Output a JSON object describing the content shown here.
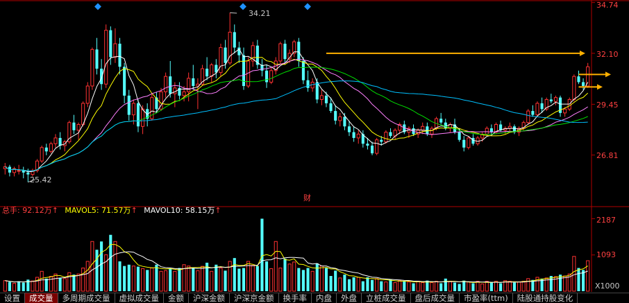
{
  "chart_data": [
    {
      "type": "candlestick",
      "price_axis_ticks": [
        "34.74",
        "32.10",
        "29.45",
        "26.81"
      ],
      "ylim": [
        24.2,
        34.8
      ],
      "annotations": {
        "high_label": "34.21",
        "low_label": "25.42",
        "finance_marker": "财"
      },
      "candles": [
        [
          26.1,
          26.4,
          25.8,
          26.2
        ],
        [
          26.2,
          26.3,
          25.7,
          25.9
        ],
        [
          25.9,
          26.2,
          25.7,
          26.1
        ],
        [
          26.0,
          26.3,
          25.8,
          26.0
        ],
        [
          26.0,
          26.2,
          25.6,
          25.9
        ],
        [
          25.9,
          26.1,
          25.4,
          25.8
        ],
        [
          25.8,
          26.1,
          25.7,
          26.0
        ],
        [
          26.0,
          26.6,
          25.9,
          26.5
        ],
        [
          26.5,
          27.3,
          26.4,
          27.2
        ],
        [
          27.2,
          27.4,
          26.8,
          27.0
        ],
        [
          27.0,
          27.5,
          26.9,
          27.4
        ],
        [
          27.4,
          27.9,
          27.2,
          27.7
        ],
        [
          27.7,
          28.0,
          27.1,
          27.3
        ],
        [
          27.3,
          27.6,
          27.0,
          27.5
        ],
        [
          27.5,
          28.6,
          27.4,
          28.5
        ],
        [
          28.5,
          28.9,
          27.9,
          28.1
        ],
        [
          28.1,
          28.5,
          27.6,
          28.4
        ],
        [
          28.4,
          29.6,
          28.3,
          29.5
        ],
        [
          29.5,
          30.6,
          29.3,
          30.4
        ],
        [
          30.4,
          32.4,
          30.2,
          32.3
        ],
        [
          32.3,
          32.9,
          31.0,
          31.3
        ],
        [
          31.3,
          31.8,
          30.2,
          30.5
        ],
        [
          30.5,
          33.6,
          30.3,
          33.3
        ],
        [
          33.3,
          33.5,
          31.5,
          31.9
        ],
        [
          31.9,
          33.4,
          31.6,
          32.6
        ],
        [
          32.6,
          32.9,
          31.0,
          31.4
        ],
        [
          31.4,
          31.6,
          29.5,
          29.9
        ],
        [
          29.9,
          30.2,
          28.6,
          28.9
        ],
        [
          28.9,
          29.7,
          28.4,
          29.5
        ],
        [
          29.5,
          29.7,
          28.0,
          28.3
        ],
        [
          28.3,
          29.4,
          27.9,
          29.2
        ],
        [
          29.2,
          29.5,
          28.3,
          28.7
        ],
        [
          28.7,
          30.0,
          28.6,
          29.8
        ],
        [
          29.8,
          30.1,
          29.0,
          29.2
        ],
        [
          29.2,
          30.3,
          29.1,
          30.1
        ],
        [
          30.1,
          31.1,
          29.8,
          30.9
        ],
        [
          30.9,
          31.7,
          29.8,
          30.0
        ],
        [
          30.0,
          30.6,
          29.3,
          30.3
        ],
        [
          30.3,
          30.6,
          29.7,
          29.9
        ],
        [
          29.9,
          30.4,
          29.6,
          30.1
        ],
        [
          30.1,
          31.1,
          29.6,
          30.8
        ],
        [
          30.8,
          31.5,
          30.2,
          30.4
        ],
        [
          30.4,
          30.8,
          29.2,
          30.5
        ],
        [
          30.5,
          31.5,
          30.4,
          31.3
        ],
        [
          31.3,
          31.9,
          30.7,
          30.9
        ],
        [
          30.9,
          31.6,
          30.6,
          31.5
        ],
        [
          31.5,
          31.8,
          30.8,
          31.1
        ],
        [
          31.1,
          32.6,
          30.9,
          32.4
        ],
        [
          32.4,
          32.8,
          31.3,
          31.6
        ],
        [
          31.6,
          34.21,
          31.5,
          33.2
        ],
        [
          33.2,
          33.6,
          32.1,
          32.4
        ],
        [
          32.4,
          32.7,
          31.6,
          32.0
        ],
        [
          32.0,
          32.4,
          30.2,
          30.4
        ],
        [
          30.4,
          31.9,
          30.3,
          31.7
        ],
        [
          31.7,
          32.7,
          31.4,
          32.5
        ],
        [
          32.5,
          32.8,
          31.3,
          31.5
        ],
        [
          31.5,
          31.8,
          30.9,
          31.2
        ],
        [
          31.2,
          31.5,
          30.3,
          30.6
        ],
        [
          30.6,
          31.4,
          30.5,
          31.2
        ],
        [
          31.2,
          31.9,
          31.0,
          31.7
        ],
        [
          31.7,
          32.7,
          31.5,
          32.6
        ],
        [
          32.6,
          32.8,
          31.6,
          31.8
        ],
        [
          31.8,
          32.3,
          31.6,
          32.1
        ],
        [
          32.1,
          32.8,
          31.9,
          32.7
        ],
        [
          32.7,
          32.9,
          31.4,
          31.7
        ],
        [
          31.7,
          31.9,
          30.5,
          30.7
        ],
        [
          30.7,
          31.2,
          30.1,
          30.3
        ],
        [
          30.3,
          30.8,
          30.1,
          30.6
        ],
        [
          30.6,
          30.8,
          29.5,
          29.7
        ],
        [
          29.7,
          30.2,
          29.4,
          29.9
        ],
        [
          29.9,
          30.1,
          29.3,
          29.5
        ],
        [
          29.5,
          29.8,
          29.0,
          29.1
        ],
        [
          29.1,
          29.4,
          28.4,
          28.6
        ],
        [
          28.6,
          29.0,
          28.3,
          28.8
        ],
        [
          28.8,
          29.0,
          28.1,
          28.3
        ],
        [
          28.3,
          28.6,
          27.8,
          28.0
        ],
        [
          28.0,
          28.3,
          27.5,
          27.7
        ],
        [
          27.7,
          28.1,
          27.4,
          27.9
        ],
        [
          27.9,
          28.1,
          27.2,
          27.4
        ],
        [
          27.4,
          27.7,
          27.1,
          27.3
        ],
        [
          27.3,
          27.5,
          26.8,
          26.9
        ],
        [
          26.9,
          27.7,
          26.8,
          27.6
        ],
        [
          27.6,
          27.8,
          27.3,
          27.5
        ],
        [
          27.5,
          28.1,
          27.4,
          28.0
        ],
        [
          28.0,
          28.2,
          27.7,
          27.8
        ],
        [
          27.8,
          28.2,
          27.6,
          28.1
        ],
        [
          28.1,
          28.5,
          27.9,
          28.4
        ],
        [
          28.4,
          28.6,
          27.9,
          28.0
        ],
        [
          28.0,
          28.3,
          27.7,
          28.2
        ],
        [
          28.2,
          28.4,
          27.8,
          27.9
        ],
        [
          27.9,
          28.2,
          27.7,
          28.1
        ],
        [
          28.1,
          28.5,
          27.9,
          28.3
        ],
        [
          28.3,
          28.5,
          27.8,
          27.9
        ],
        [
          27.9,
          28.3,
          27.7,
          28.2
        ],
        [
          28.2,
          28.8,
          28.1,
          28.7
        ],
        [
          28.7,
          29.0,
          28.4,
          28.5
        ],
        [
          28.5,
          28.7,
          28.1,
          28.2
        ],
        [
          28.2,
          28.5,
          28.0,
          28.4
        ],
        [
          28.4,
          28.7,
          27.9,
          28.0
        ],
        [
          28.0,
          28.2,
          27.5,
          27.6
        ],
        [
          27.6,
          27.8,
          27.0,
          27.2
        ],
        [
          27.2,
          27.8,
          27.1,
          27.7
        ],
        [
          27.7,
          27.9,
          27.3,
          27.4
        ],
        [
          27.4,
          27.8,
          27.3,
          27.7
        ],
        [
          27.7,
          28.0,
          27.5,
          27.9
        ],
        [
          27.9,
          28.3,
          27.8,
          28.2
        ],
        [
          28.2,
          28.4,
          27.9,
          28.0
        ],
        [
          28.0,
          28.5,
          27.9,
          28.4
        ],
        [
          28.4,
          28.6,
          28.0,
          28.1
        ],
        [
          28.1,
          28.3,
          27.9,
          28.2
        ],
        [
          28.2,
          28.5,
          28.0,
          28.3
        ],
        [
          28.3,
          28.4,
          27.9,
          28.0
        ],
        [
          28.0,
          28.3,
          27.8,
          28.2
        ],
        [
          28.2,
          28.6,
          28.1,
          28.5
        ],
        [
          28.5,
          29.2,
          28.4,
          29.1
        ],
        [
          29.1,
          29.4,
          28.8,
          28.9
        ],
        [
          28.9,
          29.6,
          28.8,
          29.5
        ],
        [
          29.5,
          29.8,
          29.0,
          29.2
        ],
        [
          29.2,
          29.8,
          29.1,
          29.7
        ],
        [
          29.7,
          30.0,
          29.5,
          29.6
        ],
        [
          29.6,
          29.9,
          29.4,
          29.8
        ],
        [
          29.8,
          29.9,
          28.8,
          29.0
        ],
        [
          29.0,
          29.3,
          28.8,
          29.2
        ],
        [
          29.2,
          29.8,
          29.1,
          29.7
        ],
        [
          29.7,
          31.0,
          29.6,
          30.9
        ],
        [
          30.9,
          31.2,
          30.5,
          30.6
        ],
        [
          30.6,
          30.8,
          30.2,
          30.4
        ],
        [
          30.4,
          31.6,
          30.3,
          31.4
        ]
      ],
      "forecast_arrows": [
        32.1,
        31.0,
        30.35
      ]
    },
    {
      "type": "bar",
      "indicator_line": {
        "label1": "总手: ",
        "value1": "92.12万",
        "label2": "MAVOL5: ",
        "value2": "71.57万",
        "label3": "MAVOL10: ",
        "value3": "58.15万",
        "arrow": "↑"
      },
      "volume_axis_ticks": [
        "2187",
        "1093"
      ],
      "volume_unit": "X1000",
      "ylim": [
        0,
        2300
      ],
      "volumes": [
        320,
        280,
        240,
        300,
        260,
        350,
        310,
        420,
        600,
        380,
        450,
        520,
        400,
        380,
        560,
        500,
        520,
        700,
        900,
        1500,
        1250,
        1500,
        1100,
        1700,
        1500,
        900,
        760,
        800,
        760,
        740,
        680,
        640,
        700,
        800,
        600,
        620,
        680,
        600,
        700,
        800,
        760,
        700,
        620,
        750,
        860,
        600,
        800,
        700,
        620,
        900,
        1000,
        680,
        700,
        900,
        780,
        760,
        2187,
        900,
        680,
        1500,
        700,
        980,
        820,
        880,
        700,
        640,
        700,
        600,
        840,
        760,
        700,
        460,
        620,
        400,
        500,
        360,
        420,
        420,
        300,
        420,
        340,
        380,
        300,
        280,
        360,
        260,
        320,
        300,
        280,
        240,
        300,
        260,
        320,
        260,
        300,
        240,
        380,
        300,
        260,
        220,
        320,
        280,
        240,
        300,
        220,
        300,
        260,
        300,
        240,
        320,
        300,
        260,
        280,
        300,
        380,
        340,
        420,
        380,
        400,
        460,
        440,
        500,
        460,
        520,
        1050,
        700,
        640,
        920
      ],
      "rising": [
        1,
        0,
        1,
        0,
        0,
        0,
        1,
        1,
        1,
        0,
        1,
        1,
        0,
        1,
        1,
        0,
        1,
        1,
        1,
        1,
        0,
        0,
        1,
        0,
        1,
        0,
        0,
        0,
        1,
        0,
        1,
        0,
        1,
        0,
        1,
        1,
        0,
        1,
        0,
        1,
        1,
        0,
        1,
        1,
        0,
        1,
        0,
        1,
        0,
        1,
        0,
        0,
        0,
        1,
        1,
        0,
        0,
        0,
        1,
        1,
        1,
        0,
        1,
        1,
        0,
        0,
        0,
        1,
        0,
        1,
        0,
        0,
        0,
        1,
        0,
        0,
        0,
        1,
        0,
        0,
        0,
        1,
        0,
        1,
        0,
        1,
        1,
        0,
        1,
        0,
        1,
        1,
        0,
        1,
        1,
        0,
        0,
        1,
        0,
        0,
        0,
        1,
        0,
        1,
        1,
        1,
        0,
        1,
        0,
        1,
        1,
        0,
        1,
        1,
        1,
        0,
        1,
        0,
        1,
        0,
        1,
        0,
        1,
        1,
        1,
        0,
        0,
        1
      ]
    }
  ],
  "bottom_tabs": [
    "设置",
    "成交量",
    "多周期成交量",
    "虚拟成交量",
    "金额",
    "沪深金额",
    "沪深京金额",
    "换手率",
    "内盘",
    "外盘",
    "立桩成交量",
    "盘后成交量",
    "市盈率(ttm)",
    "陆股通持股变化"
  ],
  "colors": {
    "up": "#ff3232",
    "down": "#54ffff",
    "axis": "#b00000",
    "ma5": "#ffffff",
    "ma10": "#ffff00",
    "ma20": "#ff80ff",
    "ma30": "#00e000",
    "ma60": "#00c0ff",
    "arrow": "#ffb000",
    "marker": "#1e90ff"
  }
}
